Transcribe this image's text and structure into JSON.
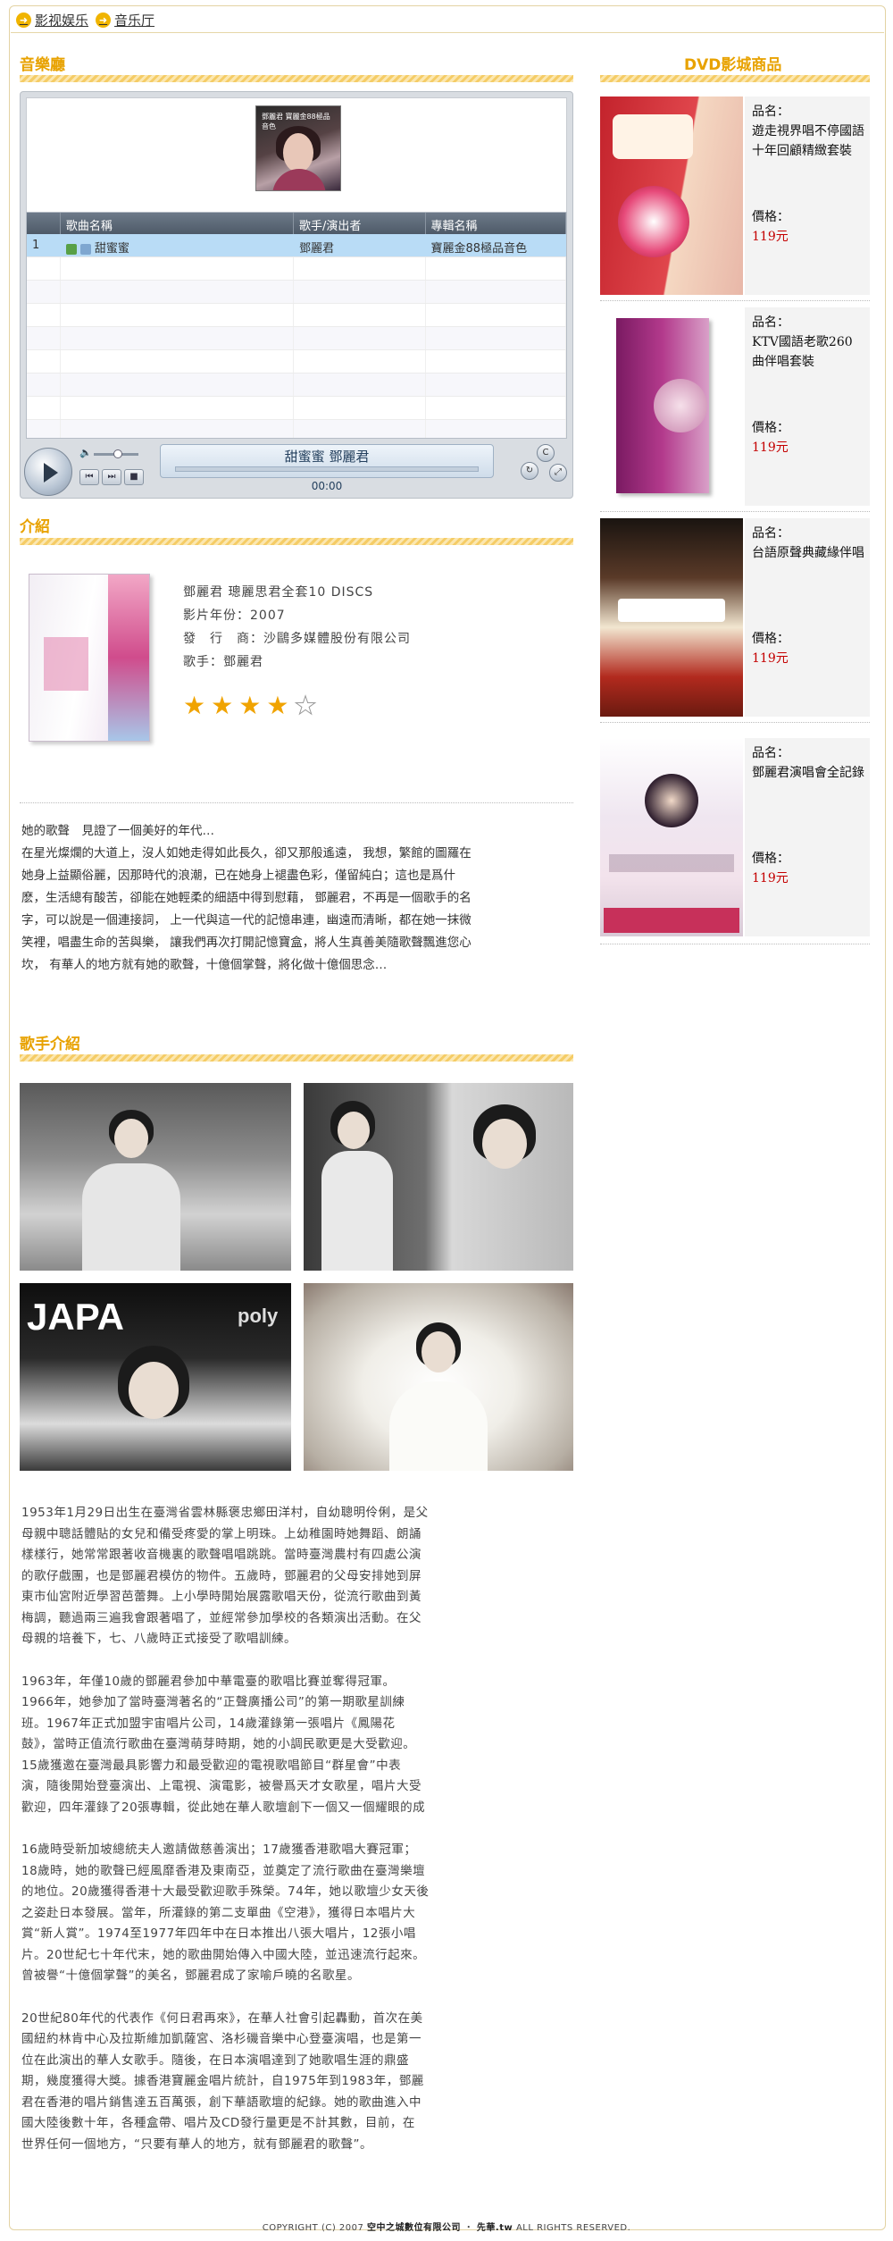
{
  "breadcrumb": [
    "影视娱乐",
    "音乐厅"
  ],
  "sections": {
    "music_hall": "音樂廳",
    "intro": "介紹",
    "singer_intro": "歌手介紹",
    "dvd_store": "DVD影城商品"
  },
  "player": {
    "cover_caption": "鄧麗君 寶麗金88極品音色",
    "columns": [
      "",
      "歌曲名稱",
      "歌手/演出者",
      "專輯名稱"
    ],
    "rows": [
      {
        "index": "1",
        "title": "甜蜜蜜",
        "artist": "鄧麗君",
        "album": "寶麗金88極品音色"
      }
    ],
    "now_playing": "甜蜜蜜 鄧麗君",
    "time": "00:00"
  },
  "product": {
    "title": "鄧麗君 璁麗思君全套10 DISCS",
    "year": "影片年份：2007",
    "publisher": "發　行　商：沙鷗多媒體股份有限公司",
    "singer": "歌手：鄧麗君",
    "rating": 4,
    "rating_max": 5
  },
  "intro_text": [
    "她的歌聲　見證了一個美好的年代…",
    "在星光燦爛的大道上，沒人如她走得如此長久，卻又那般遙遠， 我想，繁館的圖羅在",
    "她身上益顯俗麗，因那時代的浪潮，已在她身上褪盡色彩，僅留純白；這也是爲什",
    "麽，生活總有酸苦，卻能在她輕柔的細語中得到慰藉， 鄧麗君，不再是一個歌手的名",
    "字，可以說是一個連接詞， 上一代與這一代的記憶串連，幽遠而清晰，都在她一抹微",
    "笑裡，唱盡生命的苦與樂， 讓我們再次打開記憶寶盒，將人生真善美隨歌聲飄進您心",
    "坎， 有華人的地方就有她的歌聲，十億個掌聲，將化做十億個思念…"
  ],
  "bio": [
    [
      "1953年1月29日出生在臺灣省雲林縣褒忠鄉田洋村，自幼聰明伶俐，是父",
      "母親中聰話體貼的女兒和備受疼愛的掌上明珠。上幼稚園時她舞蹈、朗誦",
      "樣樣行，她常常跟著收音機裏的歌聲唱唱跳跳。當時臺灣農村有四處公演",
      "的歌仔戲團，也是鄧麗君模仿的物件。五歲時，鄧麗君的父母安排她到屏",
      "東市仙宮附近學習芭蕾舞。上小學時開始展露歌唱天份，從流行歌曲到黃",
      "梅調，聽過兩三遍我會跟著唱了，並經常參加學校的各類演出活動。在父",
      "母親的培養下，七、八歲時正式接受了歌唱訓練。"
    ],
    [
      "1963年，年僅10歲的鄧麗君參加中華電臺的歌唱比賽並奪得冠軍。",
      "1966年，她參加了當時臺灣著名的“正聲廣播公司”的第一期歌星訓練",
      "班。1967年正式加盟宇宙唱片公司，14歲灌錄第一張唱片《鳳陽花",
      "鼓》，當時正值流行歌曲在臺灣萌芽時期，她的小調民歌更是大受歡迎。",
      "15歲獲邀在臺灣最具影響力和最受歡迎的電視歌唱節目“群星會”中表",
      "演，隨後開始登臺演出、上電視、演電影，被譽爲天才女歌星，唱片大受",
      "歡迎，四年灌錄了20張專輯，從此她在華人歌壇創下一個又一個耀眼的成"
    ],
    [
      "16歲時受新加坡總統夫人邀請做慈善演出；17歲獲香港歌唱大賽冠軍；",
      "18歲時，她的歌聲已經風靡香港及東南亞，並奠定了流行歌曲在臺灣樂壇",
      "的地位。20歲獲得香港十大最受歡迎歌手殊榮。74年，她以歌壇少女天後",
      "之姿赴日本發展。當年，所灌錄的第二支單曲《空港》，獲得日本唱片大",
      "賞“新人賞”。1974至1977年四年中在日本推出八張大唱片，12張小唱",
      "片。20世紀七十年代末，她的歌曲開始傳入中國大陸，並迅速流行起來。",
      "曾被譽“十億個掌聲”的美名，鄧麗君成了家喻戶曉的名歌星。"
    ],
    [
      "20世紀80年代的代表作《何日君再來》，在華人社會引起轟動，首次在美",
      "國紐約林肯中心及拉斯維加凱薩宮、洛杉磯音樂中心登臺演唱，也是第一",
      "位在此演出的華人女歌手。隨後，在日本演唱達到了她歌唱生涯的鼎盛",
      "期，幾度獲得大獎。據香港寶麗金唱片統計，自1975年到1983年，鄧麗",
      "君在香港的唱片銷售達五百萬張，創下華語歌壇的紀錄。她的歌曲進入中",
      "國大陸後數十年，各種盒帶、唱片及CD發行量更是不計其數，目前，在",
      "世界任何一個地方，“只要有華人的地方，就有鄧麗君的歌聲”。"
    ]
  ],
  "dvd_products": [
    {
      "name_label": "品名：",
      "name": "遊走視界唱不停國語十年回顧精緻套裝",
      "price_label": "價格：",
      "price": "119元"
    },
    {
      "name_label": "品名：",
      "name": "KTV國語老歌260曲伴唱套裝",
      "price_label": "價格：",
      "price": "119元"
    },
    {
      "name_label": "品名：",
      "name": "台語原聲典藏緣伴唱",
      "price_label": "價格：",
      "price": "119元"
    },
    {
      "name_label": "品名：",
      "name": "鄧麗君演唱會全記錄",
      "price_label": "價格：",
      "price": "119元"
    }
  ],
  "footer": {
    "prefix": "COPYRIGHT (C) 2007",
    "company": "空中之城數位有限公司",
    "separator": "・",
    "brand": "先華.tw",
    "suffix": "ALL RIGHTS RESERVED."
  },
  "colors": {
    "accent": "#e8a200",
    "price": "#c40000",
    "selected_row": "#b9dcf6"
  }
}
